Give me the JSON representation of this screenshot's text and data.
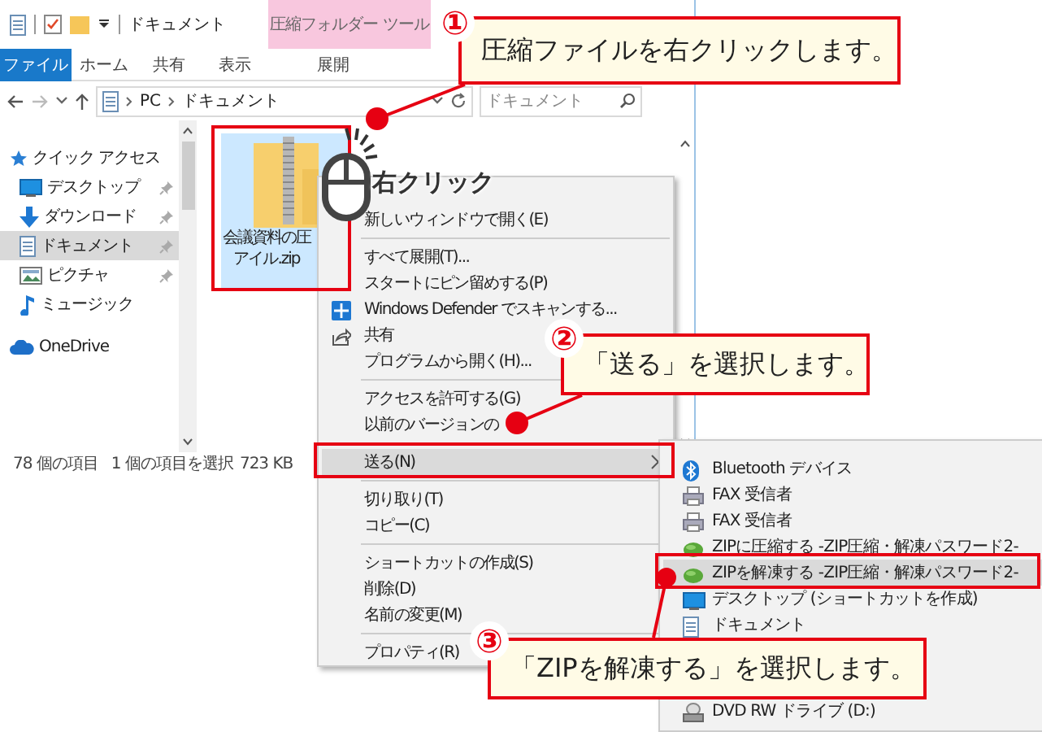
{
  "window": {
    "title": "ドキュメント",
    "contextual_group": "圧縮フォルダー ツール"
  },
  "ribbon_tabs": [
    {
      "label": "ファイル",
      "kind": "file",
      "selected": false
    },
    {
      "label": "ホーム",
      "kind": "tab",
      "selected": false
    },
    {
      "label": "共有",
      "kind": "tab",
      "selected": false
    },
    {
      "label": "表示",
      "kind": "tab",
      "selected": false
    },
    {
      "label": "展開",
      "kind": "contextual",
      "selected": false
    }
  ],
  "address": {
    "path": [
      "PC",
      "ドキュメント"
    ],
    "search_placeholder": "ドキュメント"
  },
  "navigation": [
    {
      "label": "クイック アクセス",
      "kind": "star",
      "children": [
        {
          "label": "デスクトップ",
          "kind": "desktop",
          "pinned": true,
          "selected": false
        },
        {
          "label": "ダウンロード",
          "kind": "download",
          "pinned": true,
          "selected": false
        },
        {
          "label": "ドキュメント",
          "kind": "document",
          "pinned": true,
          "selected": true
        },
        {
          "label": "ピクチャ",
          "kind": "picture",
          "pinned": true,
          "selected": false
        },
        {
          "label": "ミュージック",
          "kind": "music",
          "pinned": false,
          "selected": false
        }
      ]
    },
    {
      "label": "OneDrive",
      "kind": "cloud"
    }
  ],
  "files": [
    {
      "name_lines": [
        "会議資料の圧",
        "アイル.zip"
      ],
      "selected": true
    }
  ],
  "status_bar": {
    "item_count": "78 個の項目",
    "selection": "1 個の項目を選択",
    "size": "723 KB"
  },
  "right_click_label": "右クリック",
  "context_menu": [
    {
      "kind": "item",
      "label": "新しいウィンドウで開く(E)"
    },
    {
      "kind": "separator"
    },
    {
      "kind": "item",
      "label": "すべて展開(T)..."
    },
    {
      "kind": "item",
      "label": "スタートにピン留めする(P)"
    },
    {
      "kind": "defender",
      "label": "Windows Defender でスキャンする..."
    },
    {
      "kind": "share",
      "label": "共有"
    },
    {
      "kind": "item",
      "label": "プログラムから開く(H)..."
    },
    {
      "kind": "separator"
    },
    {
      "kind": "item",
      "label": "アクセスを許可する(G)"
    },
    {
      "kind": "item",
      "label": "以前のバージョンの"
    },
    {
      "kind": "separator"
    },
    {
      "kind": "item",
      "label": "送る(N)",
      "submenu": true,
      "selected": true
    },
    {
      "kind": "separator"
    },
    {
      "kind": "item",
      "label": "切り取り(T)"
    },
    {
      "kind": "item",
      "label": "コピー(C)"
    },
    {
      "kind": "separator"
    },
    {
      "kind": "item",
      "label": "ショートカットの作成(S)"
    },
    {
      "kind": "item",
      "label": "削除(D)"
    },
    {
      "kind": "item",
      "label": "名前の変更(M)"
    },
    {
      "kind": "separator"
    },
    {
      "kind": "item",
      "label": "プロパティ(R)"
    }
  ],
  "send_to_menu": [
    {
      "label": "Bluetooth デバイス",
      "kind": "bluetooth",
      "selected": false
    },
    {
      "label": "FAX 受信者",
      "kind": "fax",
      "selected": false
    },
    {
      "label": "FAX 受信者",
      "kind": "fax",
      "selected": false
    },
    {
      "label": "ZIPに圧縮する -ZIP圧縮・解凍パスワード2-",
      "kind": "app",
      "selected": false
    },
    {
      "label": "ZIPを解凍する -ZIP圧縮・解凍パスワード2-",
      "kind": "app",
      "selected": true
    },
    {
      "label": "デスクトップ (ショートカットを作成)",
      "kind": "desktop",
      "selected": false
    },
    {
      "label": "ドキュメント",
      "kind": "document",
      "selected": false
    },
    {
      "label": "DVD RW ドライブ (D:)",
      "kind": "drive",
      "selected": false
    }
  ],
  "callouts": [
    {
      "number": "①",
      "text": "圧縮ファイルを右クリックします。"
    },
    {
      "number": "②",
      "text": "「送る」を選択します。"
    },
    {
      "number": "③",
      "text": "「ZIPを解凍する」を選択します。"
    }
  ]
}
